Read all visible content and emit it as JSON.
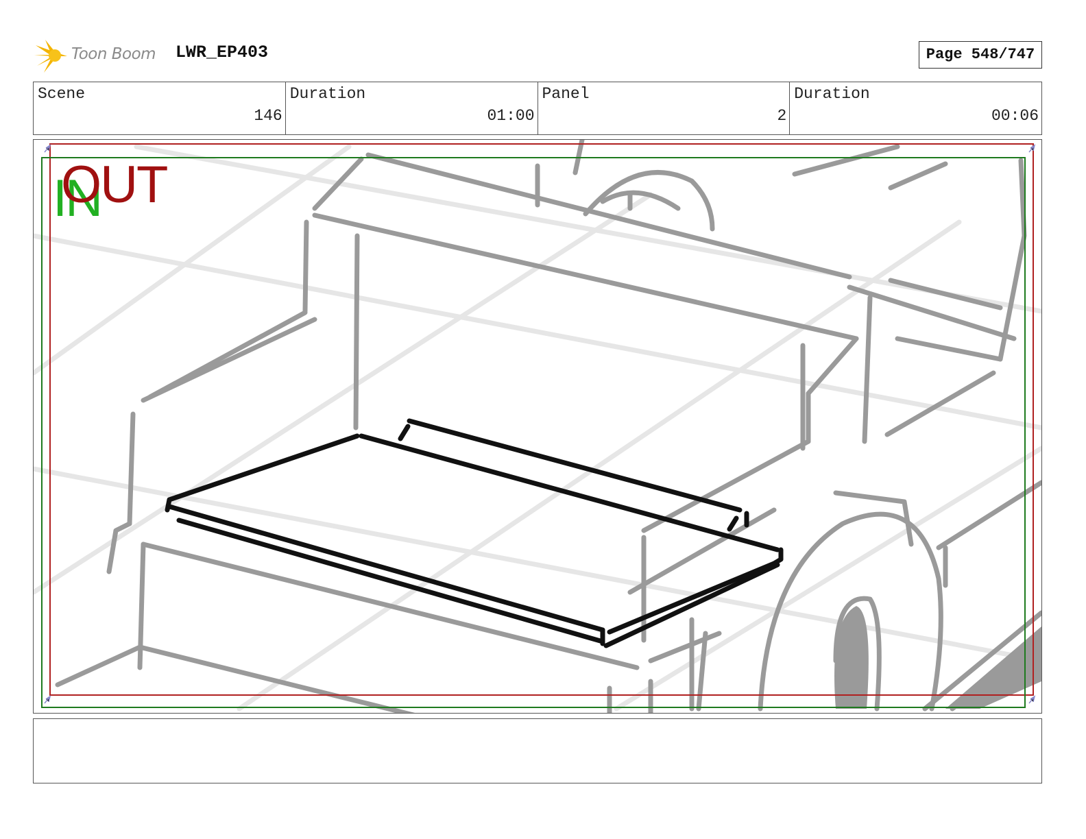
{
  "header": {
    "logo_text": "Toon Boom",
    "project_title": "LWR_EP403",
    "page_label": "Page 548/747"
  },
  "info": [
    {
      "label": "Scene",
      "value": "146"
    },
    {
      "label": "Duration",
      "value": "01:00"
    },
    {
      "label": "Panel",
      "value": "2"
    },
    {
      "label": "Duration",
      "value": "00:06"
    }
  ],
  "panel": {
    "in_label": "IN",
    "out_label": "OUT",
    "in_color": "#22b022",
    "out_color": "#a01010"
  },
  "caption": {
    "text": ""
  }
}
